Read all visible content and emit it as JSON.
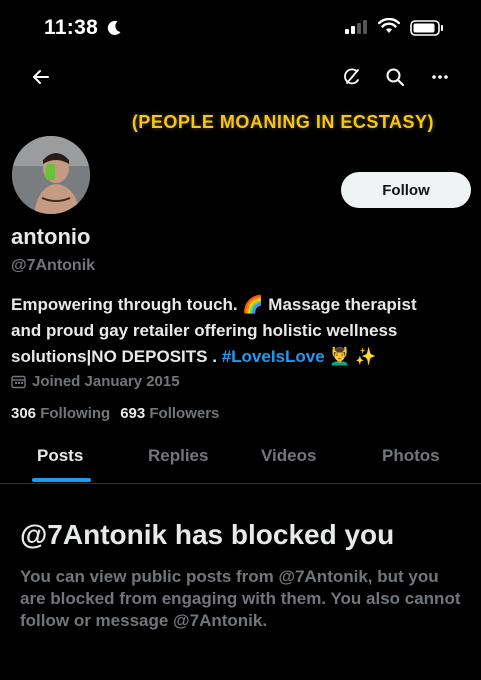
{
  "status_bar": {
    "time": "11:38",
    "icons": [
      "moon-icon",
      "cellular-signal-icon",
      "wifi-icon",
      "battery-icon"
    ]
  },
  "nav": {
    "icons": [
      "back-arrow-icon",
      "grok-icon",
      "search-icon",
      "more-icon"
    ]
  },
  "banner": {
    "text": "(PEOPLE MOANING IN ECSTASY)",
    "text_color": "#f5c518"
  },
  "profile": {
    "follow_label": "Follow",
    "display_name": "antonio",
    "handle": "@7Antonik",
    "bio": {
      "line1_text": "Empowering through touch.",
      "rainbow_emoji": "🌈",
      "line1_rest": "Massage therapist",
      "line2": "and proud gay retailer offering holistic wellness",
      "line3_text": "solutions|NO DEPOSITS .",
      "hashtag": "#LoveIsLove",
      "massage_emoji": "💆‍♂️",
      "sparkles_emoji": "✨"
    },
    "joined": "Joined January 2015",
    "following_count": "306",
    "following_label": "Following",
    "followers_count": "693",
    "followers_label": "Followers"
  },
  "tabs": [
    {
      "label": "Posts",
      "active": true
    },
    {
      "label": "Replies",
      "active": false
    },
    {
      "label": "Videos",
      "active": false
    },
    {
      "label": "Photos",
      "active": false
    }
  ],
  "blocked": {
    "title": "@7Antonik has blocked you",
    "description": "You can view public posts from @7Antonik, but you are blocked from engaging with them. You also cannot follow or message @7Antonik."
  },
  "colors": {
    "accent": "#1d9bf0",
    "background": "#000000",
    "text_primary": "#e7e9ea",
    "text_secondary": "#71767b",
    "follow_bg": "#eff3f4"
  }
}
